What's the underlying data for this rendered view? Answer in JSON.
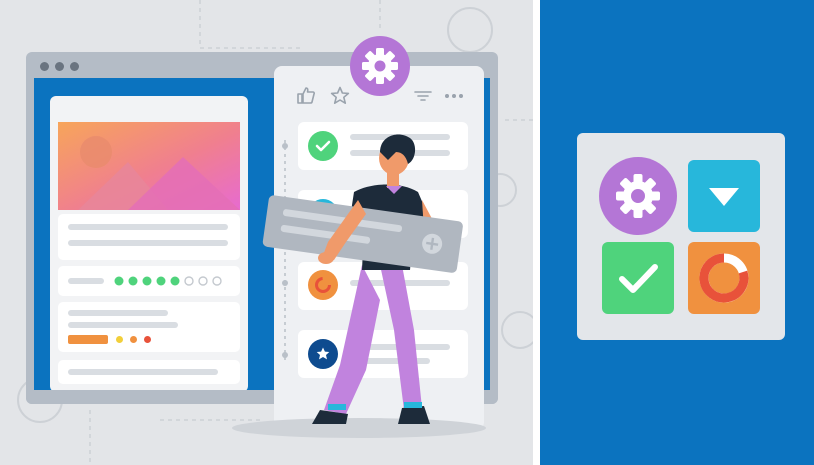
{
  "scene": {
    "description_icons": [
      "gear-icon",
      "thumbs-up-icon",
      "star-icon",
      "filter-icon",
      "more-icon",
      "check-icon",
      "plus-icon",
      "refresh-icon",
      "dropdown-triangle-icon"
    ]
  },
  "colors": {
    "left_bg": "#e3e5e8",
    "right_bg": "#0b73bf",
    "purple": "#b476d6",
    "green": "#4fd37c",
    "cyan": "#27b7db",
    "orange": "#f0913f",
    "red": "#e8523a",
    "navy": "#0e4b8f"
  },
  "progress_dots": {
    "filled": 5,
    "total": 8
  }
}
